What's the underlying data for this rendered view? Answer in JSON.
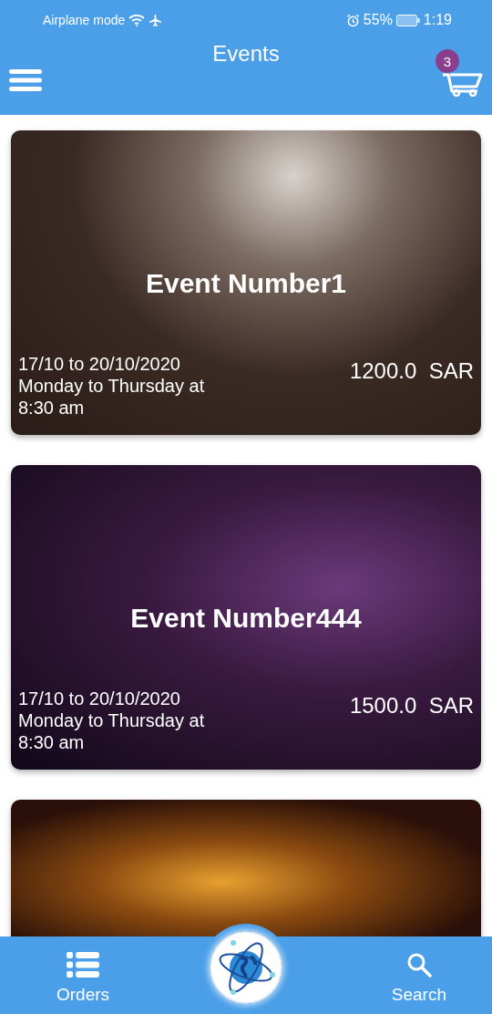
{
  "status_bar": {
    "left_text": "Airplane mode",
    "battery": "55%",
    "time": "1:19"
  },
  "app_bar": {
    "title": "Events",
    "cart_count": "3"
  },
  "events": [
    {
      "kind": "full",
      "title": "Event Number1",
      "dates": "17/10 to 20/10/2020",
      "schedule": "Monday to Thursday at 8:30 am",
      "price": "1200.0  SAR"
    },
    {
      "kind": "full",
      "title": "Event Number444",
      "dates": "17/10 to 20/10/2020",
      "schedule": "Monday to Thursday at 8:30 am",
      "price": "1500.0  SAR"
    },
    {
      "kind": "cut-off"
    }
  ],
  "bottom_nav": [
    {
      "label": "Orders",
      "kind": "orders"
    },
    {
      "kind": "logo"
    },
    {
      "label": "Search",
      "kind": "search"
    }
  ]
}
